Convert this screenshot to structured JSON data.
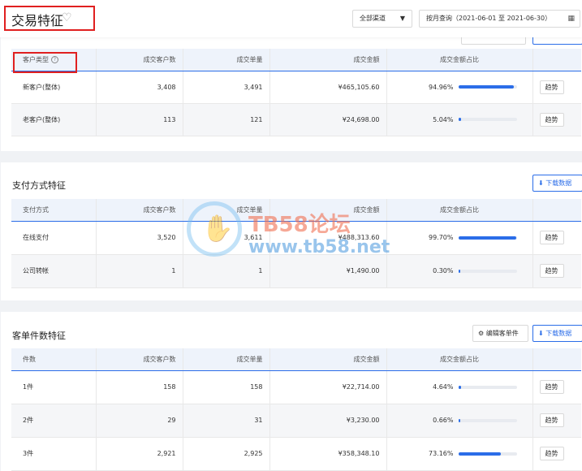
{
  "header": {
    "title": "交易特征",
    "heart_icon": "heart-icon",
    "channel": "全部渠道",
    "date_range": "按月查询（2021-06-01 至 2021-06-30）"
  },
  "columns": {
    "customers": "成交客户数",
    "orders": "成交单量",
    "amount": "成交金额",
    "share": "成交金额占比"
  },
  "trend_label": "趋势",
  "customer_type": {
    "first_col": "客户类型",
    "rows": [
      {
        "name": "新客户(整体)",
        "customers": "3,408",
        "orders": "3,491",
        "amount": "¥465,105.60",
        "share": "94.96%",
        "share_value": 94.96
      },
      {
        "name": "老客户(整体)",
        "customers": "113",
        "orders": "121",
        "amount": "¥24,698.00",
        "share": "5.04%",
        "share_value": 5.04
      }
    ]
  },
  "payment": {
    "title": "支付方式特征",
    "download": "下载数据",
    "first_col": "支付方式",
    "rows": [
      {
        "name": "在线支付",
        "customers": "3,520",
        "orders": "3,611",
        "amount": "¥488,313.60",
        "share": "99.70%",
        "share_value": 99.7
      },
      {
        "name": "公司转帐",
        "customers": "1",
        "orders": "1",
        "amount": "¥1,490.00",
        "share": "0.30%",
        "share_value": 0.3
      }
    ]
  },
  "items": {
    "title": "客单件数特征",
    "edit": "编辑客单件",
    "download": "下载数据",
    "first_col": "件数",
    "rows": [
      {
        "name": "1件",
        "customers": "158",
        "orders": "158",
        "amount": "¥22,714.00",
        "share": "4.64%",
        "share_value": 4.64
      },
      {
        "name": "2件",
        "customers": "29",
        "orders": "31",
        "amount": "¥3,230.00",
        "share": "0.66%",
        "share_value": 0.66
      },
      {
        "name": "3件",
        "customers": "2,921",
        "orders": "2,925",
        "amount": "¥358,348.10",
        "share": "73.16%",
        "share_value": 73.16
      }
    ]
  },
  "watermark": {
    "line1": "TB58论坛",
    "line2": "www.tb58.net"
  }
}
